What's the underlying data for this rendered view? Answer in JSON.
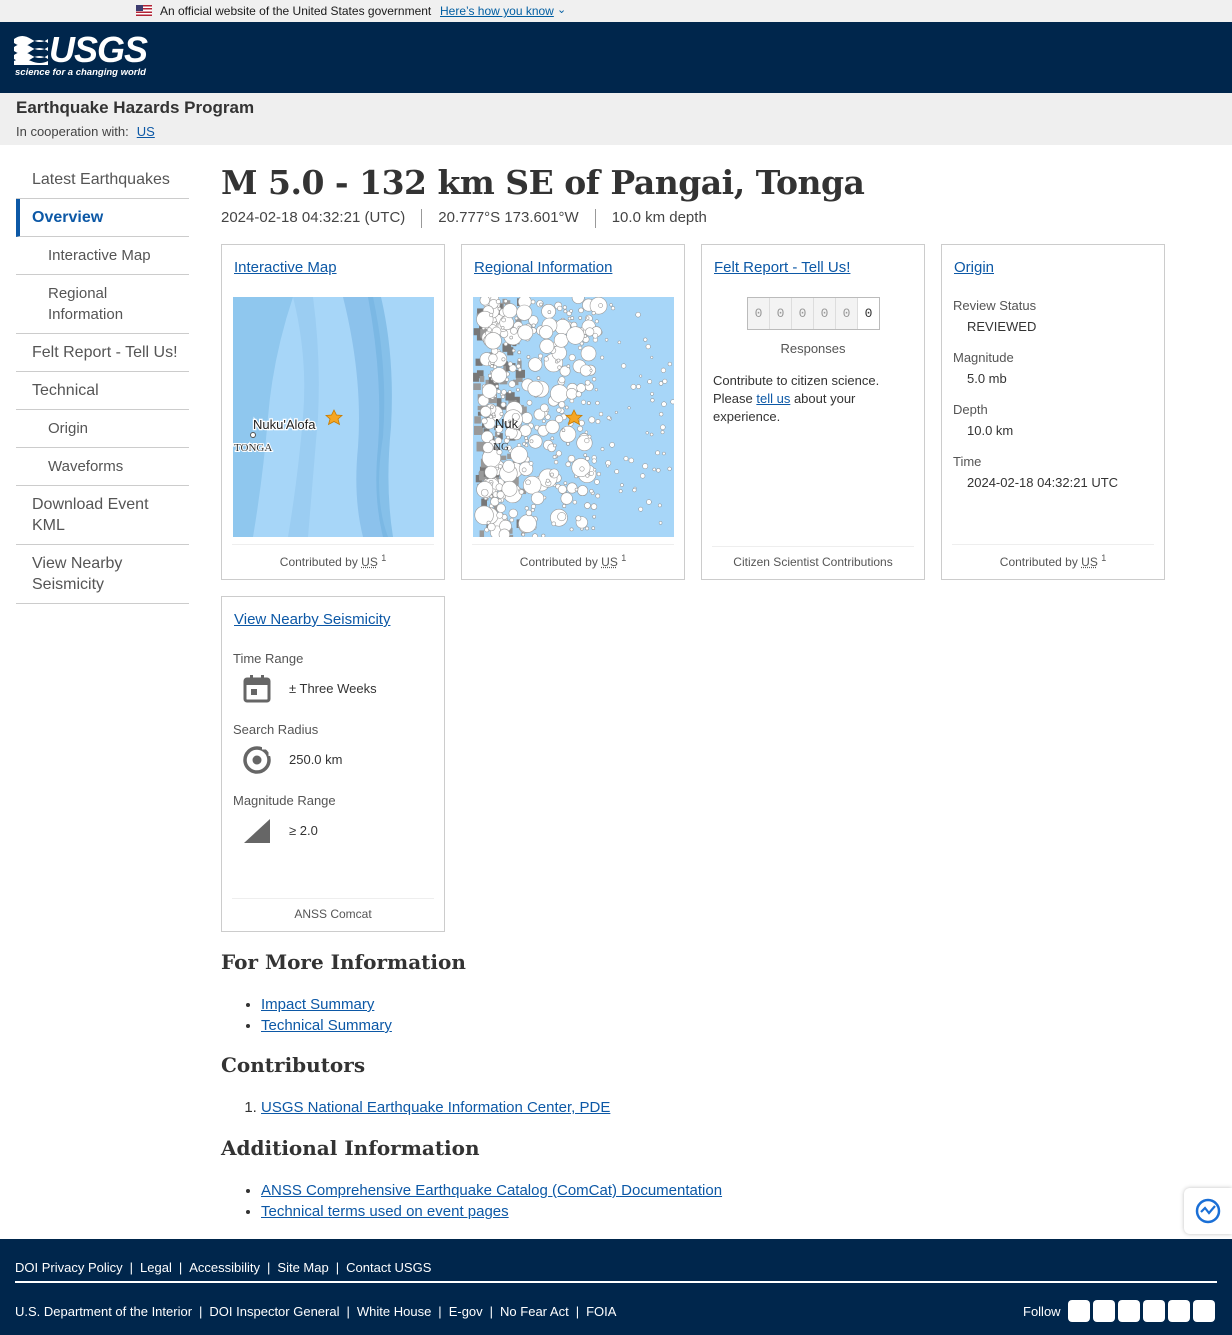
{
  "gov_banner": {
    "text": "An official website of the United States government",
    "link": "Here’s how you know"
  },
  "header": {
    "logo_word": "USGS",
    "logo_tagline": "science for a changing world"
  },
  "program": {
    "title": "Earthquake Hazards Program",
    "coop_label": "In cooperation with:",
    "coop_link": "US"
  },
  "sidebar": {
    "items": [
      {
        "label": "Latest Earthquakes"
      },
      {
        "label": "Overview"
      },
      {
        "label": "Interactive Map"
      },
      {
        "label": "Regional Information"
      },
      {
        "label": "Felt Report - Tell Us!"
      },
      {
        "label": "Technical"
      },
      {
        "label": "Origin"
      },
      {
        "label": "Waveforms"
      },
      {
        "label": "Download Event KML"
      },
      {
        "label": "View Nearby Seismicity"
      }
    ]
  },
  "event": {
    "title": "M 5.0 - 132 km SE of Pangai, Tonga",
    "time": "2024-02-18 04:32:21 (UTC)",
    "location": "20.777°S 173.601°W",
    "depth": "10.0 km depth"
  },
  "cards": {
    "map": {
      "title": "Interactive Map",
      "city": "Nuku'Alofa",
      "country": "TONGA",
      "contributed": "Contributed by",
      "contrib_abbr": "US",
      "contrib_sup": "1"
    },
    "regional": {
      "title": "Regional Information",
      "city_fragment": "Nuk",
      "country_fragment": "NG",
      "contributed": "Contributed by",
      "contrib_abbr": "US",
      "contrib_sup": "1"
    },
    "felt": {
      "title": "Felt Report - Tell Us!",
      "digits": [
        "0",
        "0",
        "0",
        "0",
        "0",
        "0"
      ],
      "responses": "Responses",
      "text_before": "Contribute to citizen science. Please ",
      "link": "tell us",
      "text_after": " about your experience.",
      "footer": "Citizen Scientist Contributions"
    },
    "origin": {
      "title": "Origin",
      "review_label": "Review Status",
      "review_value": "REVIEWED",
      "mag_label": "Magnitude",
      "mag_value": "5.0 mb",
      "depth_label": "Depth",
      "depth_value": "10.0 km",
      "time_label": "Time",
      "time_value": "2024-02-18 04:32:21 UTC",
      "contributed": "Contributed by",
      "contrib_abbr": "US",
      "contrib_sup": "1"
    },
    "nearby": {
      "title": "View Nearby Seismicity",
      "time_label": "Time Range",
      "time_value": "± Three Weeks",
      "radius_label": "Search Radius",
      "radius_value": "250.0 km",
      "mag_label": "Magnitude Range",
      "mag_value": "≥ 2.0",
      "footer": "ANSS Comcat"
    }
  },
  "more_info": {
    "heading": "For More Information",
    "links": [
      "Impact Summary",
      "Technical Summary"
    ]
  },
  "contributors": {
    "heading": "Contributors",
    "items": [
      "USGS National Earthquake Information Center, PDE"
    ]
  },
  "additional": {
    "heading": "Additional Information",
    "links": [
      "ANSS Comprehensive Earthquake Catalog (ComCat) Documentation",
      "Technical terms used on event pages"
    ]
  },
  "footer": {
    "row1": [
      "DOI Privacy Policy",
      "Legal",
      "Accessibility",
      "Site Map",
      "Contact USGS"
    ],
    "row2": [
      "U.S. Department of the Interior",
      "DOI Inspector General",
      "White House",
      "E-gov",
      "No Fear Act",
      "FOIA"
    ],
    "follow": "Follow",
    "socials": [
      "twitter-icon",
      "facebook-icon",
      "github-icon",
      "flickr-icon",
      "youtube-icon",
      "instagram-icon"
    ]
  },
  "colors": {
    "header_bg": "#00264c",
    "link": "#0c58a6",
    "ocean": "#a6d5f7"
  }
}
